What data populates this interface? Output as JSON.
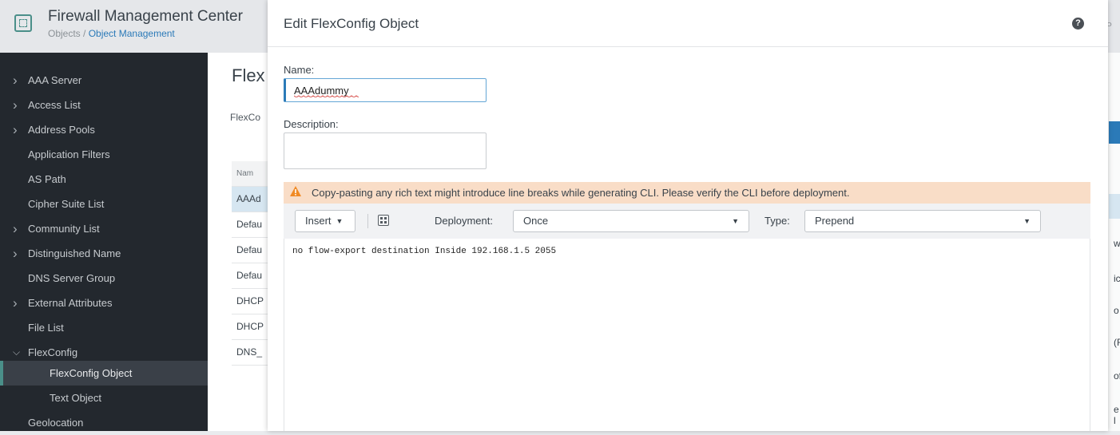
{
  "app": {
    "title": "Firewall Management Center",
    "breadcrumb_section": "Objects",
    "breadcrumb_separator": " / ",
    "breadcrumb_page": "Object Management"
  },
  "sidebar": {
    "items": [
      {
        "label": "AAA Server",
        "expandable": true,
        "expanded": false
      },
      {
        "label": "Access List",
        "expandable": true,
        "expanded": false
      },
      {
        "label": "Address Pools",
        "expandable": true,
        "expanded": false
      },
      {
        "label": "Application Filters",
        "expandable": false
      },
      {
        "label": "AS Path",
        "expandable": false
      },
      {
        "label": "Cipher Suite List",
        "expandable": false
      },
      {
        "label": "Community List",
        "expandable": true,
        "expanded": false
      },
      {
        "label": "Distinguished Name",
        "expandable": true,
        "expanded": false
      },
      {
        "label": "DNS Server Group",
        "expandable": false
      },
      {
        "label": "External Attributes",
        "expandable": true,
        "expanded": false
      },
      {
        "label": "File List",
        "expandable": false
      },
      {
        "label": "FlexConfig",
        "expandable": true,
        "expanded": true
      },
      {
        "label": "FlexConfig Object",
        "child": true,
        "selected": true
      },
      {
        "label": "Text Object",
        "child": true
      },
      {
        "label": "Geolocation",
        "expandable": false
      }
    ]
  },
  "background": {
    "heading_fragment": "Flex",
    "subheading_fragment": "FlexCo",
    "table_header_fragment": "Nam",
    "table_rows": [
      "AAAd",
      "Defau",
      "Defau",
      "Defau",
      "DHCP",
      "DHCP",
      "DNS_"
    ],
    "right_edge_fragments": [
      "w",
      "ic",
      "o",
      "(F",
      "of",
      "e l"
    ]
  },
  "modal": {
    "title": "Edit FlexConfig Object",
    "help_icon": "help-icon",
    "name_label": "Name:",
    "name_value": "AAAdummy",
    "description_label": "Description:",
    "description_value": "",
    "warning_text": "Copy-pasting any rich text might introduce line breaks while generating CLI. Please verify the CLI before deployment.",
    "toolbar": {
      "insert_label": "Insert",
      "deployment_label": "Deployment:",
      "deployment_value": "Once",
      "type_label": "Type:",
      "type_value": "Prepend"
    },
    "editor_content": "no flow-export destination Inside 192.168.1.5 2055"
  },
  "colors": {
    "accent_teal": "#4a8f89",
    "link_blue": "#2b7ab8",
    "sidebar_bg": "#23282e",
    "warning_bg": "#f9ddc7",
    "warning_icon": "#f08a24"
  }
}
